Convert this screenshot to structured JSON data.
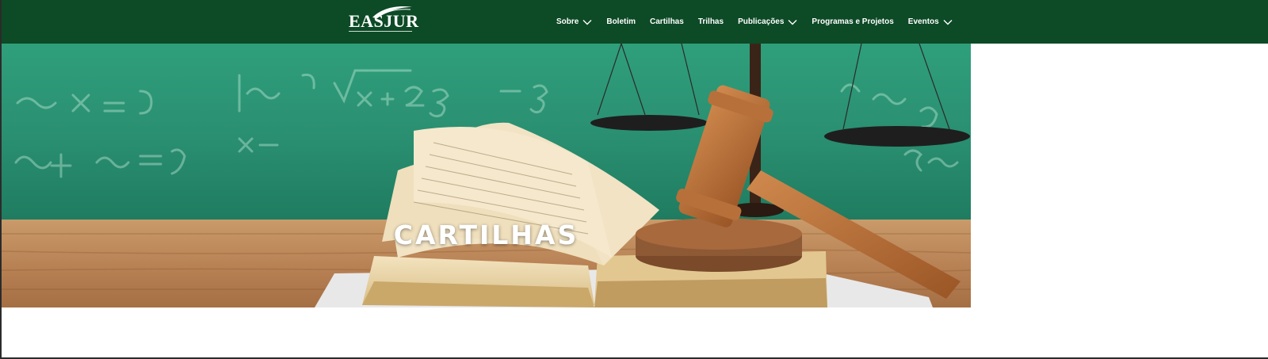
{
  "brand": {
    "name": "EASJUR"
  },
  "nav": {
    "items": [
      {
        "label": "Sobre",
        "has_dropdown": true
      },
      {
        "label": "Boletim",
        "has_dropdown": false
      },
      {
        "label": "Cartilhas",
        "has_dropdown": false
      },
      {
        "label": "Trilhas",
        "has_dropdown": false
      },
      {
        "label": "Publicações",
        "has_dropdown": true
      },
      {
        "label": "Programas e Projetos",
        "has_dropdown": false
      },
      {
        "label": "Eventos",
        "has_dropdown": true
      }
    ]
  },
  "hero": {
    "title": "CARTILHAS"
  },
  "colors": {
    "header_bg": "#0d4a26",
    "text_on_header": "#ffffff"
  },
  "icons": {
    "dropdown": "chevron-down-icon"
  }
}
